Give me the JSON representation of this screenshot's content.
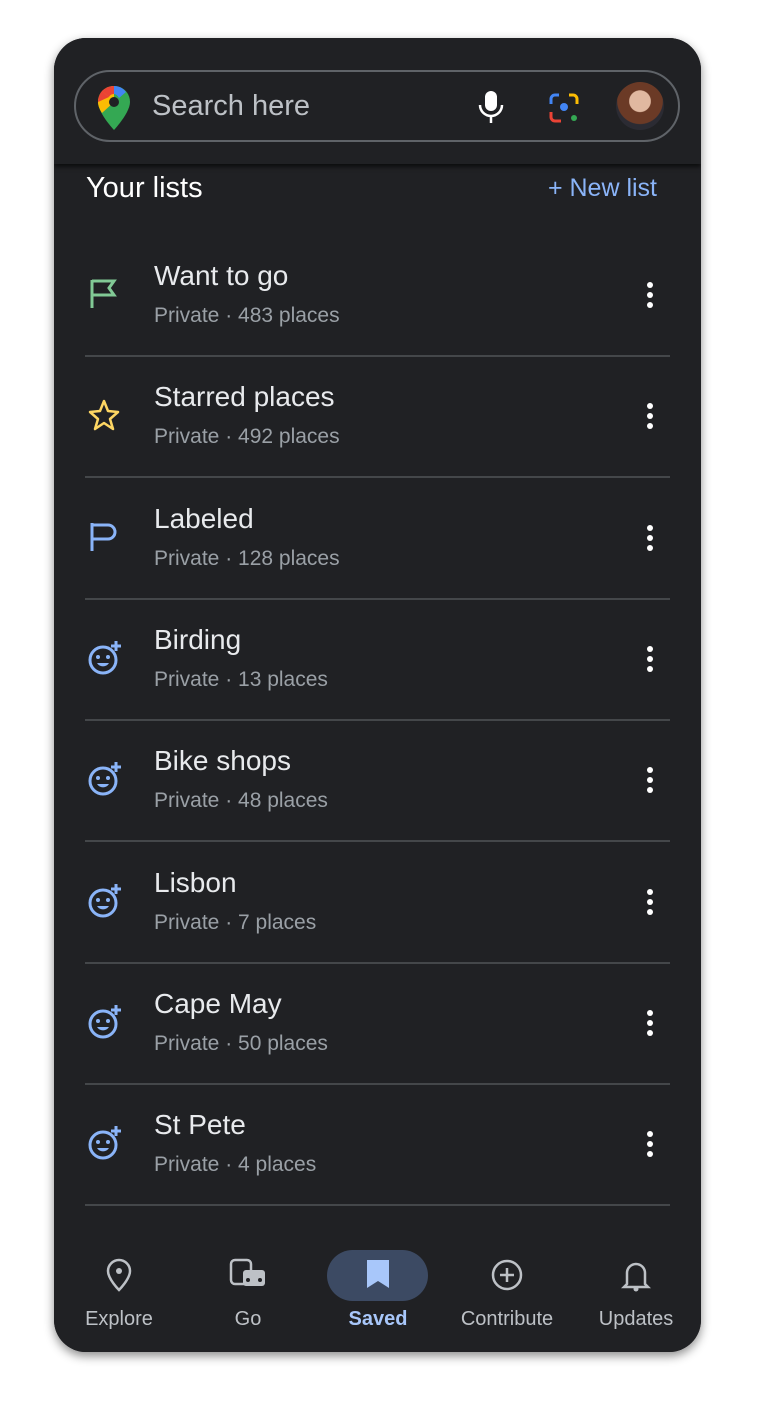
{
  "search": {
    "placeholder": "Search here"
  },
  "lists_title": "Your lists",
  "new_list": "+ New list",
  "lists": [
    {
      "title": "Want to go",
      "subtitle": "Private · 483 places",
      "icon": "flag-icon",
      "color": "#81c995"
    },
    {
      "title": "Starred places",
      "subtitle": "Private · 492 places",
      "icon": "star-icon",
      "color": "#fdd663"
    },
    {
      "title": "Labeled",
      "subtitle": "Private · 128 places",
      "icon": "label-flag-icon",
      "color": "#8ab4f8"
    },
    {
      "title": "Birding",
      "subtitle": "Private · 13 places",
      "icon": "add-reaction-icon",
      "color": "#8ab4f8"
    },
    {
      "title": "Bike shops",
      "subtitle": "Private · 48 places",
      "icon": "add-reaction-icon",
      "color": "#8ab4f8"
    },
    {
      "title": "Lisbon",
      "subtitle": "Private · 7 places",
      "icon": "add-reaction-icon",
      "color": "#8ab4f8"
    },
    {
      "title": "Cape May",
      "subtitle": "Private · 50 places",
      "icon": "add-reaction-icon",
      "color": "#8ab4f8"
    },
    {
      "title": "St Pete",
      "subtitle": "Private · 4 places",
      "icon": "add-reaction-icon",
      "color": "#8ab4f8"
    }
  ],
  "nav": [
    {
      "label": "Explore",
      "icon": "location-pin-icon"
    },
    {
      "label": "Go",
      "icon": "commute-icon"
    },
    {
      "label": "Saved",
      "icon": "bookmark-icon",
      "active": true
    },
    {
      "label": "Contribute",
      "icon": "add-circle-icon"
    },
    {
      "label": "Updates",
      "icon": "bell-icon"
    }
  ],
  "colors": {
    "accent": "#8ab4f8",
    "background": "#202124"
  }
}
